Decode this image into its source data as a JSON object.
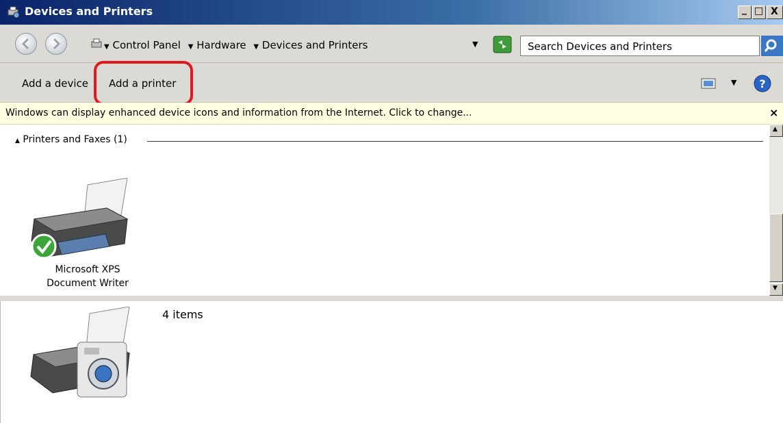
{
  "window": {
    "title": "Devices and Printers",
    "controls": {
      "minimize": "_",
      "maximize": "□",
      "close": "X"
    }
  },
  "address_bar": {
    "breadcrumbs": [
      "Control Panel",
      "Hardware",
      "Devices and Printers"
    ],
    "search_placeholder": "Search Devices and Printers"
  },
  "command_bar": {
    "add_device": "Add a device",
    "add_printer": "Add a printer"
  },
  "info_bar": {
    "message": "Windows can display enhanced device icons and information from the Internet. Click to change...",
    "close": "×"
  },
  "content": {
    "group": {
      "label": "Printers and Faxes (1)"
    },
    "devices": [
      {
        "name": "Microsoft XPS Document Writer",
        "line1": "Microsoft XPS",
        "line2": "Document Writer",
        "icon": "printer-icon",
        "status": "default-check"
      }
    ]
  },
  "details": {
    "count": "4 items",
    "icon": "devices-printers-icon"
  },
  "colors": {
    "highlight": "#e3171d",
    "infobar": "#ffffe1",
    "titlebar": "#0a246a"
  }
}
